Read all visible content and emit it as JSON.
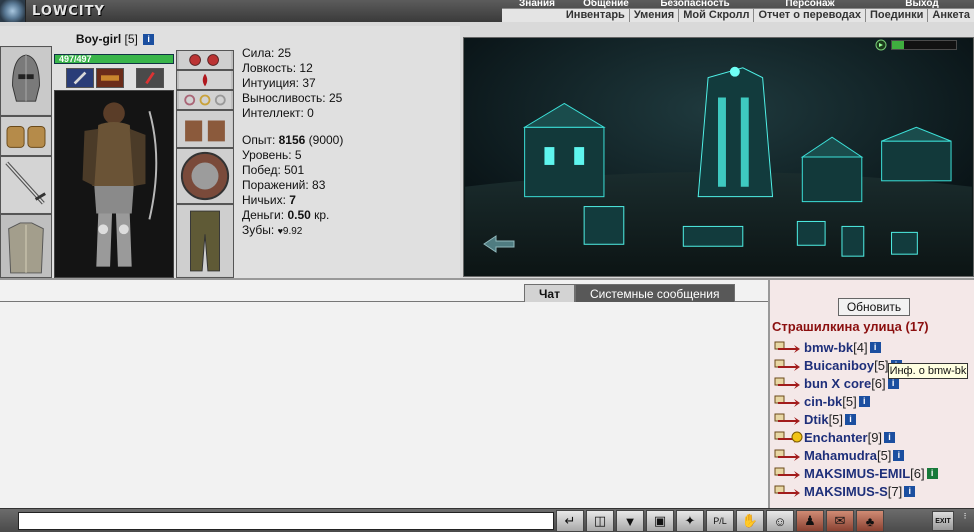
{
  "header": {
    "logo_text": "LOWCITY",
    "top_menu": [
      {
        "label": "Знания",
        "w": 60
      },
      {
        "label": "Общение",
        "w": 60
      },
      {
        "label": "Безопасность",
        "w": 110
      },
      {
        "label": "Персонаж",
        "w": 120
      },
      {
        "label": "Выход",
        "w": 70
      }
    ],
    "sub_menu": [
      "Инвентарь",
      "Умения",
      "Мой Скролл",
      "Отчет о переводах",
      "Поединки",
      "Анкета"
    ]
  },
  "character": {
    "name": "Boy-girl",
    "level": "[5]",
    "hp_text": "497/497",
    "hp_fraction": 1.0
  },
  "stats": {
    "strength": "Сила: 25",
    "agility": "Ловкость: 12",
    "intuition": "Интуиция: 37",
    "endurance": "Выносливость: 25",
    "intellect": "Интеллект: 0",
    "exp_label": "Опыт: ",
    "exp_value": "8156",
    "exp_next": " (9000)",
    "level_line": "Уровень: 5",
    "wins_line": "Побед: 501",
    "losses_line": "Поражений: 83",
    "draws_label": "Ничьих: ",
    "draws_value": "7",
    "money_label": "Деньги: ",
    "money_value": "0.50",
    "money_unit": " кр.",
    "teeth_label": "Зубы: ",
    "teeth_value": "9.92"
  },
  "chat": {
    "tab_chat": "Чат",
    "tab_system": "Системные сообщения",
    "input_value": ""
  },
  "users_panel": {
    "refresh_label": "Обновить",
    "room_title": "Страшилкина улица (17)",
    "tooltip": "Инф. о bmw-bk",
    "users": [
      {
        "name": "bmw-bk",
        "level": "[4]",
        "special": false,
        "info": "blue"
      },
      {
        "name": "Buicaniboy",
        "level": "[5]",
        "special": false,
        "info": "blue"
      },
      {
        "name": "bun X core",
        "level": "[6]",
        "special": false,
        "info": "blue"
      },
      {
        "name": "cin-bk",
        "level": "[5]",
        "special": false,
        "info": "blue"
      },
      {
        "name": "Dtik",
        "level": "[5]",
        "special": false,
        "info": "blue"
      },
      {
        "name": "Enchanter",
        "level": "[9]",
        "special": true,
        "info": "blue"
      },
      {
        "name": "Mahamudra",
        "level": "[5]",
        "special": false,
        "info": "blue"
      },
      {
        "name": "MAKSIMUS-EMIL",
        "level": "[6]",
        "special": false,
        "info": "green"
      },
      {
        "name": "MAKSIMUS-S",
        "level": "[7]",
        "special": false,
        "info": "blue"
      }
    ]
  },
  "bottom": {
    "exit_label": "EXIT",
    "icons": [
      "return-icon",
      "eraser-icon",
      "filter-icon",
      "save-icon",
      "fight-icon",
      "pl-icon",
      "hand-icon",
      "smile-icon",
      "person-icon",
      "gift-icon",
      "trade-icon",
      "exit-icon"
    ],
    "icon_glyphs": [
      "↵",
      "◫",
      "▼",
      "▣",
      "✦",
      "P/L",
      "✋",
      "☺",
      "♟",
      "✉",
      "♣",
      ""
    ]
  },
  "colors": {
    "room_title": "#8b0f0f",
    "user_name": "#1e2f7a",
    "hp_bar": "#39b54a",
    "chat_bg": "#f2f2f2",
    "users_bg": "#f4e8e8"
  }
}
